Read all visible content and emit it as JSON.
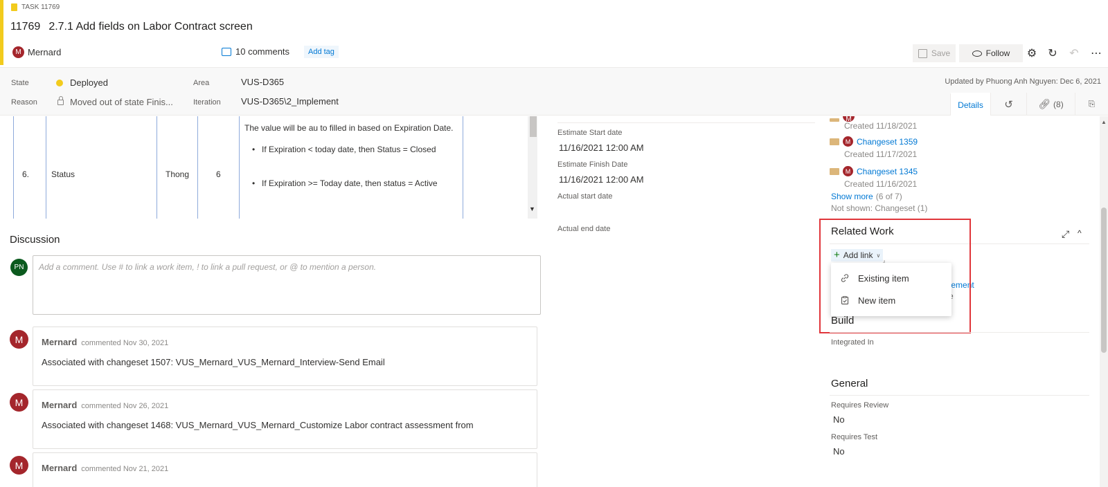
{
  "header": {
    "work_item_type": "TASK 11769",
    "id": "11769",
    "title": "2.7.1 Add fields on Labor Contract screen",
    "assignee": {
      "initial": "M",
      "name": "Mernard"
    },
    "comments_count": "10 comments",
    "add_tag": "Add tag",
    "toolbar": {
      "save": "Save",
      "follow": "Follow",
      "gear": "⚙",
      "refresh": "↻",
      "undo": "↶",
      "more": "⋯"
    }
  },
  "fields": {
    "state_label": "State",
    "state_value": "Deployed",
    "reason_label": "Reason",
    "reason_value": "Moved out of state Finis...",
    "area_label": "Area",
    "area_value": "VUS-D365",
    "iteration_label": "Iteration",
    "iteration_value": "VUS-D365\\2_Implement",
    "updated": "Updated by Phuong Anh Nguyen: Dec 6, 2021",
    "colors": {
      "state_deployed": "#f2cb1d",
      "accent": "#0078d4"
    }
  },
  "tabs": [
    {
      "label": "Details"
    },
    {
      "label": "↺"
    },
    {
      "label": "(8)"
    },
    {
      "label": "⎘"
    }
  ],
  "description_row": {
    "no": "6.",
    "field": "Status",
    "owner": "Thong",
    "num": "6",
    "intro": "The value will be au to filled in based on Expiration Date.",
    "bullets": [
      "If Expiration < today date, then Status = Closed",
      "If Expiration >= Today date, then status = Active"
    ]
  },
  "discussion": {
    "title": "Discussion",
    "user_initials": "PN",
    "placeholder": "Add a comment. Use # to link a work item, ! to link a pull request, or @ to mention a person.",
    "comments": [
      {
        "initial": "M",
        "author": "Mernard",
        "when": "commented Nov 30, 2021",
        "text": "Associated with changeset 1507: VUS_Mernard_VUS_Mernard_Interview-Send Email"
      },
      {
        "initial": "M",
        "author": "Mernard",
        "when": "commented Nov 26, 2021",
        "text": "Associated with changeset 1468: VUS_Mernard_VUS_Mernard_Customize Labor contract assessment from"
      },
      {
        "initial": "M",
        "author": "Mernard",
        "when": "commented Nov 21, 2021",
        "text": ""
      }
    ]
  },
  "planning": {
    "estimate_start_label": "Estimate Start date",
    "estimate_start_value": "11/16/2021 12:00 AM",
    "estimate_finish_label": "Estimate Finish Date",
    "estimate_finish_value": "11/16/2021 12:00 AM",
    "actual_start_label": "Actual start date",
    "actual_end_label": "Actual end date"
  },
  "development": {
    "items": [
      {
        "initial": "M",
        "label": "",
        "created": "Created 11/18/2021"
      },
      {
        "initial": "M",
        "label": "Changeset 1359",
        "created": "Created 11/17/2021"
      },
      {
        "initial": "M",
        "label": "Changeset 1345",
        "created": "Created 11/16/2021"
      }
    ],
    "show_more": "Show more",
    "show_more_count": "(6 of 7)",
    "not_shown": "Not shown: Changeset (1)"
  },
  "related_work": {
    "title": "Related Work",
    "add_link": "Add link",
    "menu": [
      {
        "icon": "link-icon",
        "label": "Existing item"
      },
      {
        "icon": "new-item-icon",
        "label": "New item"
      }
    ],
    "behind_text_1": "agement",
    "behind_text_2": "e"
  },
  "build": {
    "title": "Build",
    "integrated_in_label": "Integrated In"
  },
  "general": {
    "title": "General",
    "requires_review_label": "Requires Review",
    "requires_review_value": "No",
    "requires_test_label": "Requires Test",
    "requires_test_value": "No"
  }
}
